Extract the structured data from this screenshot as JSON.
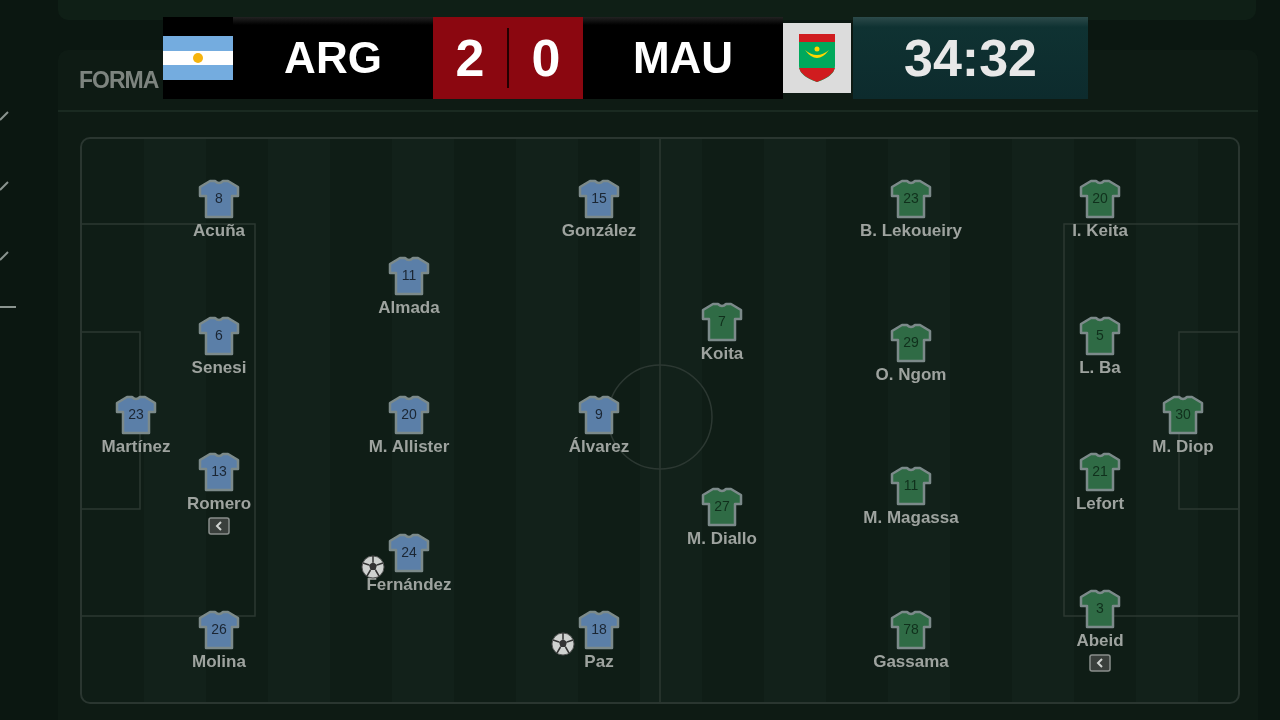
{
  "header": {
    "title": "FORMA"
  },
  "scoreboard": {
    "home": {
      "code": "ARG",
      "score": "2"
    },
    "away": {
      "code": "MAU",
      "score": "0"
    },
    "clock": "34:32"
  },
  "home": {
    "lines": [
      [
        {
          "number": "23",
          "name": "Martínez",
          "scored": false,
          "substituted": false
        }
      ],
      [
        {
          "number": "8",
          "name": "Acuña",
          "scored": false,
          "substituted": false
        },
        {
          "number": "6",
          "name": "Senesi",
          "scored": false,
          "substituted": false
        },
        {
          "number": "13",
          "name": "Romero",
          "scored": false,
          "substituted": true
        },
        {
          "number": "26",
          "name": "Molina",
          "scored": false,
          "substituted": false
        }
      ],
      [
        {
          "number": "11",
          "name": "Almada",
          "scored": false,
          "substituted": false
        },
        {
          "number": "20",
          "name": "M. Allister",
          "scored": false,
          "substituted": false
        },
        {
          "number": "24",
          "name": "Fernández",
          "scored": true,
          "substituted": false
        }
      ],
      [
        {
          "number": "15",
          "name": "González",
          "scored": false,
          "substituted": false
        },
        {
          "number": "9",
          "name": "Álvarez",
          "scored": false,
          "substituted": false
        },
        {
          "number": "18",
          "name": "Paz",
          "scored": true,
          "substituted": false
        }
      ]
    ]
  },
  "away": {
    "lines": [
      [
        {
          "number": "7",
          "name": "Koita",
          "scored": false,
          "substituted": false
        },
        {
          "number": "27",
          "name": "M. Diallo",
          "scored": false,
          "substituted": false
        }
      ],
      [
        {
          "number": "23",
          "name": "B. Lekoueiry",
          "scored": false,
          "substituted": false
        },
        {
          "number": "29",
          "name": "O. Ngom",
          "scored": false,
          "substituted": false
        },
        {
          "number": "11",
          "name": "M. Magassa",
          "scored": false,
          "substituted": false
        },
        {
          "number": "78",
          "name": "Gassama",
          "scored": false,
          "substituted": false
        }
      ],
      [
        {
          "number": "20",
          "name": "I. Keita",
          "scored": false,
          "substituted": false
        },
        {
          "number": "5",
          "name": "L. Ba",
          "scored": false,
          "substituted": false
        },
        {
          "number": "21",
          "name": "Lefort",
          "scored": false,
          "substituted": false
        },
        {
          "number": "3",
          "name": "Abeid",
          "scored": false,
          "substituted": true
        }
      ],
      [
        {
          "number": "30",
          "name": "M. Diop",
          "scored": false,
          "substituted": false
        }
      ]
    ]
  }
}
